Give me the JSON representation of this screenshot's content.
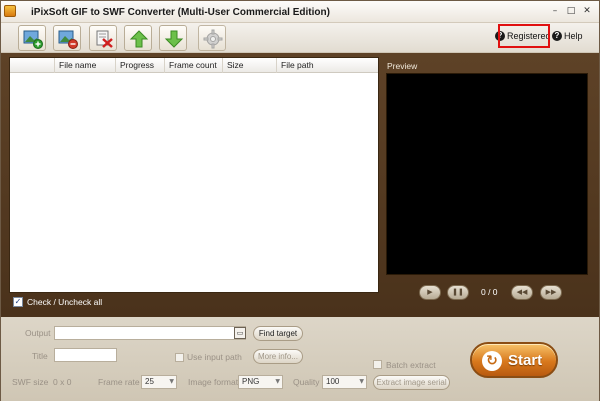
{
  "window": {
    "title": "iPixSoft GIF to SWF Converter (Multi-User Commercial Edition)",
    "controls": [
      "–",
      "□",
      "✕"
    ]
  },
  "toolbar": {
    "buttons": [
      {
        "name": "add-file-button",
        "icon": "add-image-icon"
      },
      {
        "name": "remove-file-button",
        "icon": "remove-image-icon"
      },
      {
        "name": "clear-list-button",
        "icon": "clear-icon"
      },
      {
        "name": "move-up-button",
        "icon": "arrow-up-icon"
      },
      {
        "name": "move-down-button",
        "icon": "arrow-down-icon"
      },
      {
        "name": "settings-button",
        "icon": "gear-icon"
      }
    ],
    "registered_label": "Registered",
    "help_label": "Help"
  },
  "file_list": {
    "columns": [
      "File name",
      "Progress",
      "Frame count",
      "Size",
      "File path"
    ],
    "rows": [],
    "check_all_label": "Check / Uncheck all"
  },
  "preview": {
    "label": "Preview",
    "counter": "0 / 0"
  },
  "settings": {
    "output_label": "Output",
    "output_value": "",
    "find_target_label": "Find target",
    "title_label": "Title",
    "title_value": "",
    "use_input_path_label": "Use input path",
    "more_info_label": "More info...",
    "swf_size_label": "SWF size",
    "swf_size_value": "0 x 0",
    "frame_rate_label": "Frame rate",
    "frame_rate_value": "25",
    "image_format_label": "Image format",
    "image_format_value": "PNG",
    "quality_label": "Quality",
    "quality_value": "100",
    "batch_extract_label": "Batch extract",
    "extract_serial_label": "Extract image serial",
    "start_label": "Start"
  },
  "colors": {
    "main_panel": "#553a22",
    "settings_bg": "#d6cfc0",
    "start_button": "#d8781c",
    "highlight_box": "#e01010"
  }
}
